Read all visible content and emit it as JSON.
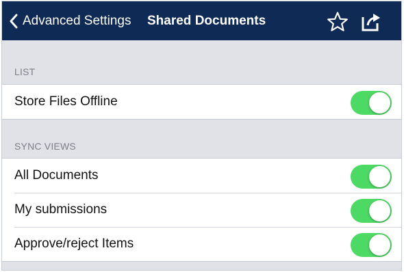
{
  "nav": {
    "back_label": "Advanced Settings",
    "title": "Shared Documents",
    "icons": [
      "chevron-left-icon",
      "star-icon",
      "share-icon"
    ]
  },
  "sections": [
    {
      "header": "LIST",
      "rows": [
        {
          "label": "Store Files Offline",
          "on": true
        }
      ]
    },
    {
      "header": "SYNC VIEWS",
      "rows": [
        {
          "label": "All Documents",
          "on": true
        },
        {
          "label": "My submissions",
          "on": true
        },
        {
          "label": "Approve/reject Items",
          "on": true
        }
      ]
    }
  ],
  "colors": {
    "navbar": "#0f2b55",
    "background": "#e1e2e7",
    "toggle_on": "#4cd964"
  }
}
